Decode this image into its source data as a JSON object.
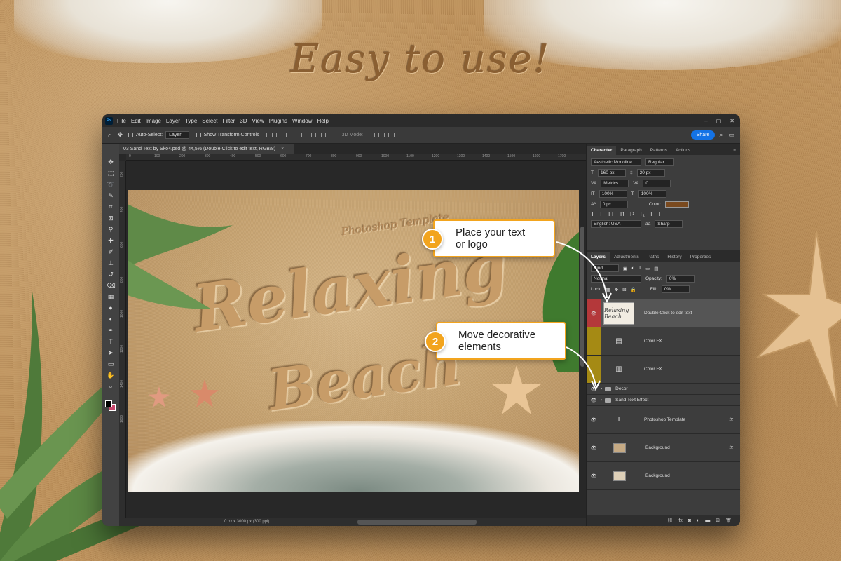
{
  "headline": "Easy to use!",
  "menubar": {
    "logo": "Ps",
    "items": [
      "File",
      "Edit",
      "Image",
      "Layer",
      "Type",
      "Select",
      "Filter",
      "3D",
      "View",
      "Plugins",
      "Window",
      "Help"
    ]
  },
  "options_bar": {
    "auto_select_label": "Auto-Select:",
    "auto_select_value": "Layer",
    "transform_label": "Show Transform Controls",
    "mode_label": "3D Mode:",
    "share_label": "Share"
  },
  "document": {
    "tab_title": "03 Sand Text by Sko4.psd @ 44,5% (Double Click to edit text, RGB/8)",
    "status": "0 px x 3000 px (300 ppi)",
    "canvas_words": [
      "Relaxing",
      "Beach"
    ],
    "canvas_subtitle": "Photoshop Template"
  },
  "ruler": {
    "top": [
      "0",
      "100",
      "200",
      "300",
      "400",
      "500",
      "600",
      "700",
      "800",
      "900",
      "1000",
      "1100",
      "1200",
      "1300",
      "1400",
      "1500",
      "1600",
      "1700"
    ],
    "left": [
      "200",
      "400",
      "600",
      "800",
      "1000",
      "1200",
      "1400",
      "1600"
    ]
  },
  "character_panel": {
    "tabs": [
      "Character",
      "Paragraph",
      "Patterns",
      "Actions"
    ],
    "font_family": "Aesthetic Monoline",
    "font_style": "Regular",
    "size": "160 px",
    "leading": "20 px",
    "kerning": "Metrics",
    "tracking": "0",
    "vscale": "100%",
    "hscale": "100%",
    "baseline": "0 px",
    "color_label": "Color:",
    "language": "English: USA",
    "antialias": "Sharp"
  },
  "layers_panel": {
    "tabs": [
      "Layers",
      "Adjustments",
      "Paths",
      "History",
      "Properties"
    ],
    "filter_label": "Kind",
    "blend_mode": "Normal",
    "opacity_label": "Opacity:",
    "opacity_value": "0%",
    "lock_label": "Lock:",
    "fill_label": "Fill:",
    "fill_value": "0%",
    "layers": [
      {
        "name": "Double Click to edit text",
        "thumb": "Relaxing Beach"
      },
      {
        "name": "Color FX"
      },
      {
        "name": "Color FX"
      },
      {
        "name": "Decor"
      },
      {
        "name": "Sand Text Effect"
      },
      {
        "name": "Photoshop Template",
        "fx": "fx"
      },
      {
        "name": "Background",
        "fx": "fx"
      },
      {
        "name": "Background"
      }
    ]
  },
  "callouts": [
    {
      "number": "1",
      "text_line1": "Place your text",
      "text_line2": "or logo"
    },
    {
      "number": "2",
      "text_line1": "Move decorative",
      "text_line2": "elements"
    }
  ],
  "colors": {
    "accent": "#f2a41e",
    "ps_blue": "#1473e6",
    "text_color": "#7a4a1f",
    "layer_red": "#b4383a",
    "layer_olive": "#a58a14"
  }
}
